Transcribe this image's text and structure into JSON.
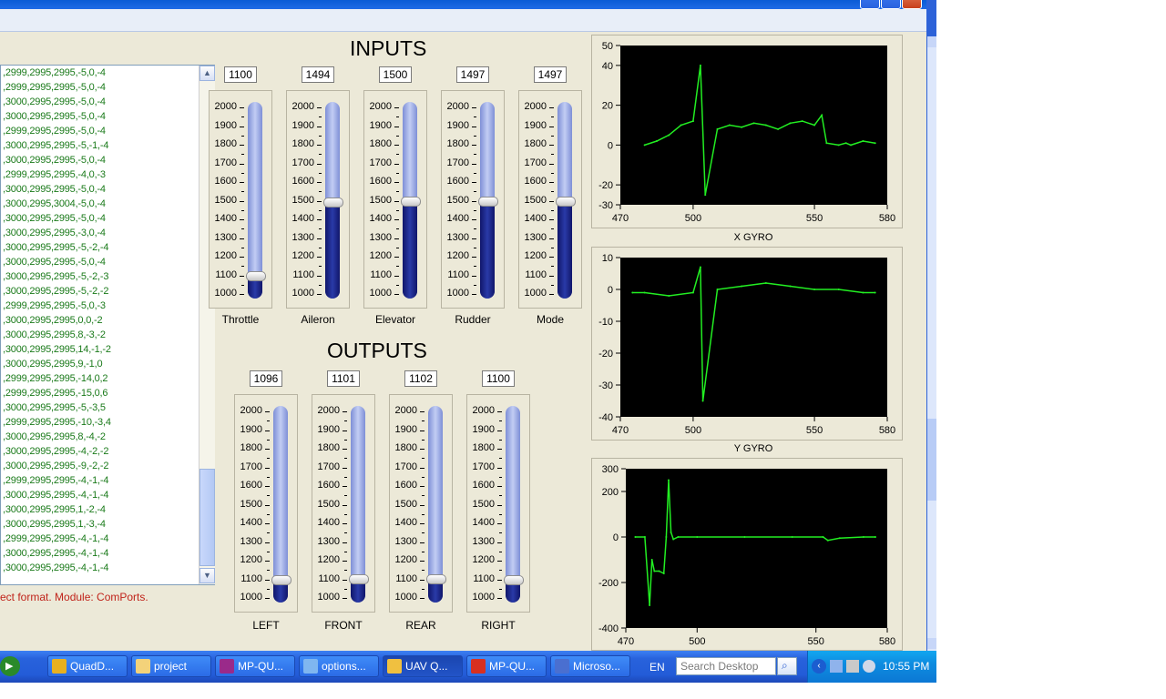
{
  "log": {
    "lines": [
      ",2999,2995,2995,-5,0,-4",
      ",2999,2995,2995,-5,0,-4",
      ",3000,2995,2995,-5,0,-4",
      ",3000,2995,2995,-5,0,-4",
      ",2999,2995,2995,-5,0,-4",
      ",3000,2995,2995,-5,-1,-4",
      ",3000,2995,2995,-5,0,-4",
      ",2999,2995,2995,-4,0,-3",
      ",3000,2995,2995,-5,0,-4",
      ",3000,2995,3004,-5,0,-4",
      ",3000,2995,2995,-5,0,-4",
      ",3000,2995,2995,-3,0,-4",
      ",3000,2995,2995,-5,-2,-4",
      ",3000,2995,2995,-5,0,-4",
      ",3000,2995,2995,-5,-2,-3",
      ",3000,2995,2995,-5,-2,-2",
      ",2999,2995,2995,-5,0,-3",
      ",3000,2995,2995,0,0,-2",
      ",3000,2995,2995,8,-3,-2",
      ",3000,2995,2995,14,-1,-2",
      ",3000,2995,2995,9,-1,0",
      ",2999,2995,2995,-14,0,2",
      ",2999,2995,2995,-15,0,6",
      ",3000,2995,2995,-5,-3,5",
      ",2999,2995,2995,-10,-3,4",
      ",3000,2995,2995,8,-4,-2",
      ",3000,2995,2995,-4,-2,-2",
      ",3000,2995,2995,-9,-2,-2",
      ",2999,2995,2995,-4,-1,-4",
      ",3000,2995,2995,-4,-1,-4",
      ",3000,2995,2995,1,-2,-4",
      ",3000,2995,2995,1,-3,-4",
      ",2999,2995,2995,-4,-1,-4",
      ",3000,2995,2995,-4,-1,-4",
      ",3000,2995,2995,-4,-1,-4"
    ],
    "scroll_position_fraction": 0.8
  },
  "status_message": "ect format. Module: ComPorts.",
  "inputs": {
    "heading": "INPUTS",
    "channels": [
      {
        "label": "Throttle",
        "value": "1100"
      },
      {
        "label": "Aileron",
        "value": "1494"
      },
      {
        "label": "Elevator",
        "value": "1500"
      },
      {
        "label": "Rudder",
        "value": "1497"
      },
      {
        "label": "Mode",
        "value": "1497"
      }
    ]
  },
  "outputs": {
    "heading": "OUTPUTS",
    "channels": [
      {
        "label": "LEFT",
        "value": "1096"
      },
      {
        "label": "FRONT",
        "value": "1101"
      },
      {
        "label": "REAR",
        "value": "1102"
      },
      {
        "label": "RIGHT",
        "value": "1100"
      }
    ]
  },
  "slider_scale": {
    "ticks": [
      "2000",
      "1900",
      "1800",
      "1700",
      "1600",
      "1500",
      "1400",
      "1300",
      "1200",
      "1100",
      "1000"
    ],
    "min": 1000,
    "max": 2000
  },
  "chart_data": [
    {
      "type": "line",
      "title": "X GYRO",
      "xlim": [
        470,
        580
      ],
      "ylim": [
        -30,
        50
      ],
      "xticks": [
        "470",
        "500",
        "550",
        "580"
      ],
      "yticks": [
        "50",
        "40",
        "20",
        "0",
        "-20",
        "-30"
      ],
      "series_color": "#22ee22",
      "series": [
        {
          "x": [
            480,
            485,
            490,
            495,
            500,
            503,
            505,
            510,
            515,
            520,
            525,
            530,
            535,
            540,
            545,
            550,
            553,
            555,
            560,
            563,
            565,
            570,
            575
          ],
          "y": [
            0,
            2,
            5,
            10,
            12,
            40,
            -25,
            8,
            10,
            9,
            11,
            10,
            8,
            11,
            12,
            10,
            15,
            1,
            0,
            1,
            0,
            2,
            1
          ]
        }
      ]
    },
    {
      "type": "line",
      "title": "Y GYRO",
      "xlim": [
        470,
        580
      ],
      "ylim": [
        -40,
        10
      ],
      "xticks": [
        "470",
        "500",
        "550",
        "580"
      ],
      "yticks": [
        "10",
        "0",
        "-10",
        "-20",
        "-30",
        "-40"
      ],
      "series_color": "#22ee22",
      "series": [
        {
          "x": [
            475,
            480,
            490,
            500,
            503,
            504,
            510,
            520,
            530,
            540,
            550,
            560,
            570,
            575
          ],
          "y": [
            -1,
            -1,
            -2,
            -1,
            7,
            -35,
            0,
            1,
            2,
            1,
            0,
            0,
            -1,
            -1
          ]
        }
      ]
    },
    {
      "type": "line",
      "title": "",
      "xlim": [
        470,
        580
      ],
      "ylim": [
        -400,
        300
      ],
      "xticks": [
        "470",
        "500",
        "550",
        "580"
      ],
      "yticks": [
        "300",
        "200",
        "0",
        "-200",
        "-400"
      ],
      "series_color": "#22ee22",
      "series": [
        {
          "x": [
            474,
            478,
            480,
            481,
            482,
            484,
            486,
            487,
            488,
            489,
            490,
            492,
            500,
            520,
            540,
            553,
            555,
            560,
            570,
            575
          ],
          "y": [
            0,
            0,
            -300,
            -100,
            -150,
            -150,
            -160,
            0,
            250,
            20,
            -10,
            0,
            0,
            0,
            0,
            0,
            -15,
            -5,
            0,
            0
          ]
        }
      ]
    }
  ],
  "taskbar": {
    "buttons": [
      {
        "label": "QuadD...",
        "icon": "chrome-icon"
      },
      {
        "label": "project",
        "icon": "folder-icon"
      },
      {
        "label": "MP-QU...",
        "icon": "winrar-icon"
      },
      {
        "label": "options...",
        "icon": "document-icon"
      },
      {
        "label": "UAV Q...",
        "icon": "app-window-icon",
        "active": true
      },
      {
        "label": "MP-QU...",
        "icon": "pdf-icon"
      },
      {
        "label": "Microso...",
        "icon": "word-icon"
      }
    ],
    "language": "EN",
    "search_placeholder": "Search Desktop",
    "clock": "10:55 PM"
  }
}
